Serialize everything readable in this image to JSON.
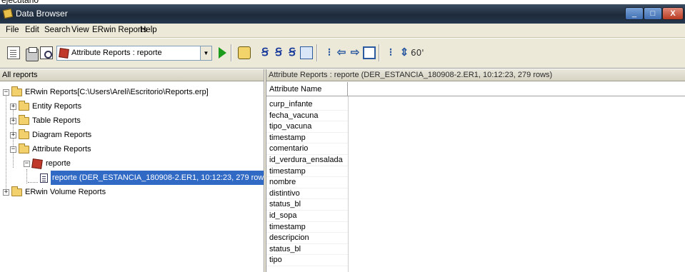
{
  "window": {
    "caption_fragment": "ejecutarlo",
    "title": "Data Browser"
  },
  "menu": [
    "File",
    "Edit",
    "Search",
    "View",
    "ERwin Reports",
    "Help"
  ],
  "toolbar": {
    "report_select_value": "Attribute Reports : reporte",
    "glasses_label": "60'"
  },
  "left_pane": {
    "header": "All reports",
    "tree": [
      {
        "label": "ERwin Reports[C:\\Users\\Areli\\Escritorio\\Reports.erp]",
        "expander": "−"
      },
      {
        "label": "Entity Reports",
        "expander": "+"
      },
      {
        "label": "Table Reports",
        "expander": "+"
      },
      {
        "label": "Diagram Reports",
        "expander": "+"
      },
      {
        "label": "Attribute Reports",
        "expander": "−"
      },
      {
        "label": "reporte",
        "expander": "−"
      },
      {
        "label": "reporte  (DER_ESTANCIA_180908-2.ER1,  10:12:23, 279 rows)"
      },
      {
        "label": "ERwin Volume Reports",
        "expander": "+"
      }
    ]
  },
  "right_pane": {
    "header": "Attribute Reports : reporte   (DER_ESTANCIA_180908-2.ER1,  10:12:23, 279 rows)",
    "column_title": "Attribute Name",
    "rows": [
      "curp_infante",
      "fecha_vacuna",
      "tipo_vacuna",
      "timestamp",
      "comentario",
      "id_verdura_ensalada",
      "timestamp",
      "nombre",
      "distintivo",
      "status_bl",
      "id_sopa",
      "timestamp",
      "descripcion",
      "status_bl",
      "tipo"
    ]
  },
  "colors": {
    "titlebar": "#1d2a3a",
    "selection": "#316ac5",
    "chrome": "#ece9d8"
  }
}
